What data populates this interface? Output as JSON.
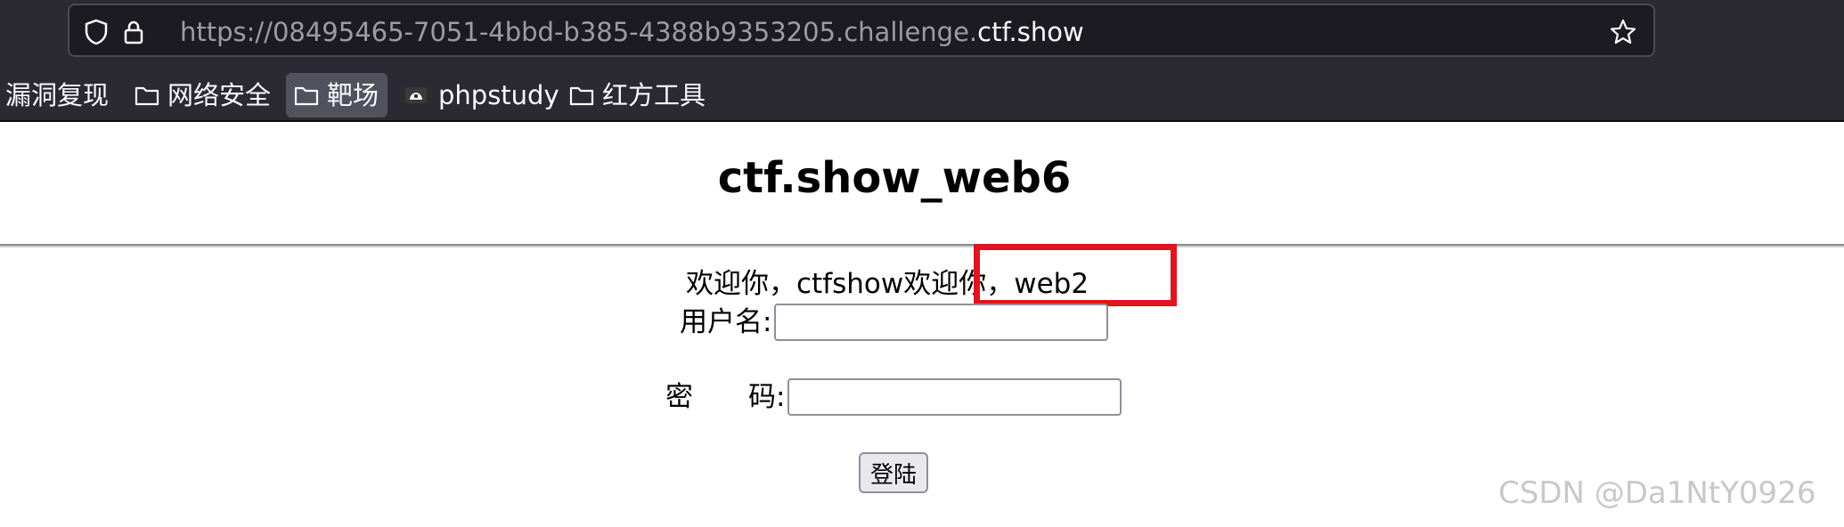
{
  "browser": {
    "url_prefix": "https://08495465-7051-4bbd-b385-4388b9353205.challenge.",
    "url_domain": "ctf.show",
    "bookmarks": [
      {
        "label": "漏洞复现",
        "icon": "none"
      },
      {
        "label": "网络安全",
        "icon": "folder-icon"
      },
      {
        "label": "靶场",
        "icon": "folder-icon",
        "active": true
      },
      {
        "label": "phpstudy",
        "icon": "phpstudy-favicon"
      },
      {
        "label": "红方工具",
        "icon": "folder-icon"
      }
    ]
  },
  "page": {
    "title": "ctf.show_web6",
    "welcome": "欢迎你，ctfshow欢迎你，web2",
    "username_label": "用户名:",
    "password_label": "密　　码:",
    "username_value": "",
    "password_value": "",
    "login_button": "登陆"
  },
  "watermark": "CSDN @Da1NtY0926",
  "colors": {
    "highlight_box": "#e0141e",
    "toolbar_bg": "#2b2a33",
    "urlbar_bg": "#1c1b22"
  }
}
